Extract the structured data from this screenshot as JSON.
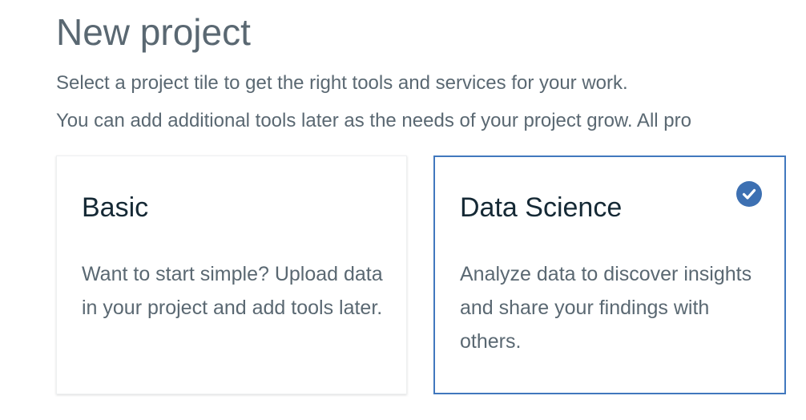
{
  "header": {
    "title": "New project",
    "intro_line_1": "Select a project tile to get the right tools and services for your work.",
    "intro_line_2": "You can add additional tools later as the needs of your project grow. All pro"
  },
  "tiles": [
    {
      "title": "Basic",
      "description": "Want to start simple? Upload data in your project and add tools later.",
      "selected": false
    },
    {
      "title": "Data Science",
      "description": "Analyze data to discover insights and share your findings with others.",
      "selected": true,
      "check_icon": "checkmark-circle-icon"
    }
  ],
  "colors": {
    "accent": "#3d70b2",
    "selected_border": "#4178be",
    "title_text": "#5a6872",
    "tile_title_text": "#152935"
  }
}
